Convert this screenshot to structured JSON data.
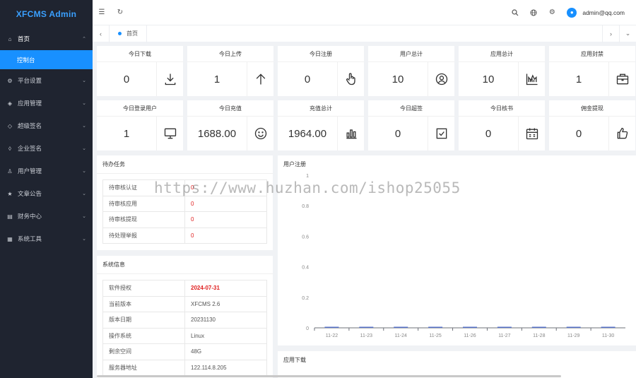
{
  "app": {
    "title": "XFCMS Admin"
  },
  "sidebar": {
    "items": [
      {
        "label": "首页",
        "icon": "home-icon",
        "glyph": "⌂"
      },
      {
        "label": "控制台",
        "sub": true
      },
      {
        "label": "平台设置",
        "icon": "gear-icon",
        "glyph": "⚙"
      },
      {
        "label": "应用管理",
        "icon": "app-icon",
        "glyph": "◈"
      },
      {
        "label": "超级签名",
        "icon": "shield-icon",
        "glyph": "◇"
      },
      {
        "label": "企业签名",
        "icon": "tag-icon",
        "glyph": "◊"
      },
      {
        "label": "用户管理",
        "icon": "user-icon",
        "glyph": "♙"
      },
      {
        "label": "文章公告",
        "icon": "star-icon",
        "glyph": "★"
      },
      {
        "label": "财务中心",
        "icon": "finance-icon",
        "glyph": "▤"
      },
      {
        "label": "系统工具",
        "icon": "tools-icon",
        "glyph": "▦"
      }
    ]
  },
  "header": {
    "username": "admin@qq.com"
  },
  "tabs": [
    {
      "label": "首页"
    }
  ],
  "stats": [
    {
      "title": "今日下载",
      "value": "0",
      "icon": "download-icon"
    },
    {
      "title": "今日上传",
      "value": "1",
      "icon": "upload-arrow-icon"
    },
    {
      "title": "今日注册",
      "value": "0",
      "icon": "pointer-hand-icon"
    },
    {
      "title": "用户总计",
      "value": "10",
      "icon": "user-circle-icon"
    },
    {
      "title": "应用总计",
      "value": "10",
      "icon": "chart-area-icon"
    },
    {
      "title": "应用封禁",
      "value": "1",
      "icon": "briefcase-icon"
    },
    {
      "title": "今日登录用户",
      "value": "1",
      "icon": "monitor-icon"
    },
    {
      "title": "今日充值",
      "value": "1688.00",
      "icon": "smile-icon"
    },
    {
      "title": "充值总计",
      "value": "1964.00",
      "icon": "bar-chart-icon"
    },
    {
      "title": "今日超签",
      "value": "0",
      "icon": "checkbox-icon"
    },
    {
      "title": "今日核书",
      "value": "0",
      "icon": "calendar-icon"
    },
    {
      "title": "佣金提现",
      "value": "0",
      "icon": "thumbs-up-icon"
    }
  ],
  "tasks": {
    "title": "待办任务",
    "rows": [
      {
        "label": "待审核认证",
        "value": "0"
      },
      {
        "label": "待审核应用",
        "value": "0"
      },
      {
        "label": "待审核提现",
        "value": "0"
      },
      {
        "label": "待处理举报",
        "value": "0"
      }
    ]
  },
  "sysinfo": {
    "title": "系统信息",
    "rows": [
      {
        "label": "软件授权",
        "value": "2024-07-31",
        "highlight": true
      },
      {
        "label": "当前版本",
        "value": "XFCMS 2.6"
      },
      {
        "label": "版本日期",
        "value": "20231130"
      },
      {
        "label": "操作系统",
        "value": "Linux"
      },
      {
        "label": "剩余空间",
        "value": "48G"
      },
      {
        "label": "服务器地址",
        "value": "122.114.8.205"
      }
    ]
  },
  "chart_data": {
    "type": "bar",
    "title": "用户注册",
    "categories": [
      "11-22",
      "11-23",
      "11-24",
      "11-25",
      "11-26",
      "11-27",
      "11-28",
      "11-29",
      "11-30"
    ],
    "values": [
      0,
      0,
      0,
      0,
      0,
      0,
      0,
      0,
      0
    ],
    "yticks": [
      "0",
      "0.2",
      "0.4",
      "0.6",
      "0.8",
      "1"
    ],
    "ylim": [
      0,
      1
    ],
    "grid": false,
    "bar_color": "#5470c6"
  },
  "download_panel": {
    "title": "应用下载"
  },
  "watermark": "https://www.huzhan.com/ishop25055"
}
